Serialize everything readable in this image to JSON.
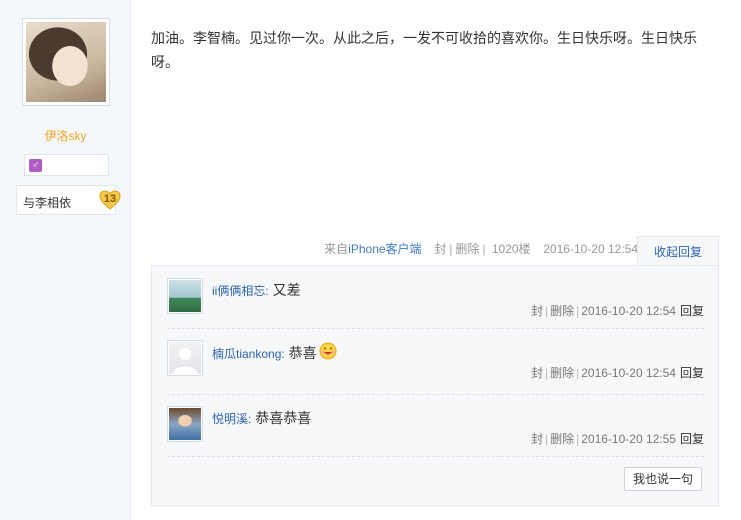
{
  "author": {
    "name": "伊洛sky",
    "level_name": "与李相依",
    "level_num": "13",
    "accent": "#f5a623"
  },
  "post": {
    "content": "加油。李智楠。见过你一次。从此之后，一发不可收拾的喜欢你。生日快乐呀。生日快乐呀。",
    "source_prefix": "来自",
    "source_device": "iPhone客户端",
    "seal": "封",
    "delete": "删除",
    "floor": "1020楼",
    "time": "2016-10-20 12:54",
    "collapse_label": "收起回复"
  },
  "replies": [
    {
      "user": "ii俩俩相忘",
      "content": "又差",
      "seal": "封",
      "delete": "删除",
      "time": "2016-10-20 12:54",
      "reply_label": "回复"
    },
    {
      "user": "楠瓜tiankong",
      "content": "恭喜",
      "emoji": "smile-emoji",
      "seal": "封",
      "delete": "删除",
      "time": "2016-10-20 12:54",
      "reply_label": "回复"
    },
    {
      "user": "悦明溪",
      "content": "恭喜恭喜",
      "seal": "封",
      "delete": "删除",
      "time": "2016-10-20 12:55",
      "reply_label": "回复"
    }
  ],
  "say_button": "我也说一句",
  "link_color": "#2d64b3"
}
